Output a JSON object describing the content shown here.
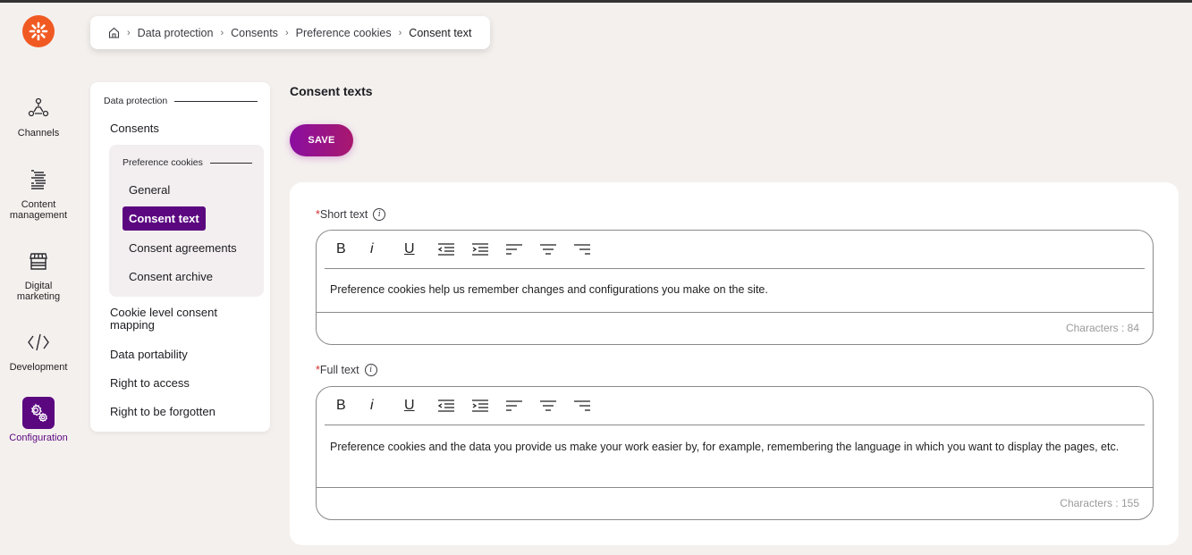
{
  "app": {
    "logo_icon": "kentico-logo-icon",
    "brand_color": "#f05a22",
    "accent_color": "#5b0780"
  },
  "rail": {
    "items": [
      {
        "label": "Channels",
        "icon": "channels-icon"
      },
      {
        "label": "Content management",
        "icon": "content-management-icon"
      },
      {
        "label": "Digital marketing",
        "icon": "digital-marketing-icon"
      },
      {
        "label": "Development",
        "icon": "code-icon"
      },
      {
        "label": "Configuration",
        "icon": "gears-icon",
        "active": true
      }
    ]
  },
  "breadcrumb": {
    "home_icon": "home-icon",
    "items": [
      "Data protection",
      "Consents",
      "Preference cookies",
      "Consent text"
    ],
    "separator": "›"
  },
  "subnav": {
    "section_label": "Data protection",
    "items_top": [
      "Consents"
    ],
    "group": {
      "label": "Preference cookies",
      "items": [
        "General",
        "Consent text",
        "Consent agreements",
        "Consent archive"
      ],
      "active": "Consent text"
    },
    "items_bottom": [
      "Cookie level consent mapping",
      "Data portability",
      "Right to access",
      "Right to be forgotten"
    ]
  },
  "main": {
    "title": "Consent texts",
    "save_label": "SAVE",
    "fields": [
      {
        "required_mark": "*",
        "label": "Short text",
        "info_icon": "info-icon",
        "value": "Preference cookies help us remember changes and configurations you make on the site.",
        "char_count": "Characters : 84"
      },
      {
        "required_mark": "*",
        "label": "Full text",
        "info_icon": "info-icon",
        "value": "Preference cookies and the data you provide us make your work easier by, for example, remembering the language in which you want to display the pages, etc.",
        "char_count": "Characters : 155"
      }
    ],
    "toolbar": [
      {
        "name": "bold",
        "glyph": "B"
      },
      {
        "name": "italic",
        "glyph": "i"
      },
      {
        "name": "underline",
        "glyph": "U"
      },
      {
        "name": "outdent",
        "glyph": ""
      },
      {
        "name": "indent",
        "glyph": ""
      },
      {
        "name": "align-left",
        "glyph": ""
      },
      {
        "name": "align-center",
        "glyph": ""
      },
      {
        "name": "align-right",
        "glyph": ""
      }
    ]
  }
}
